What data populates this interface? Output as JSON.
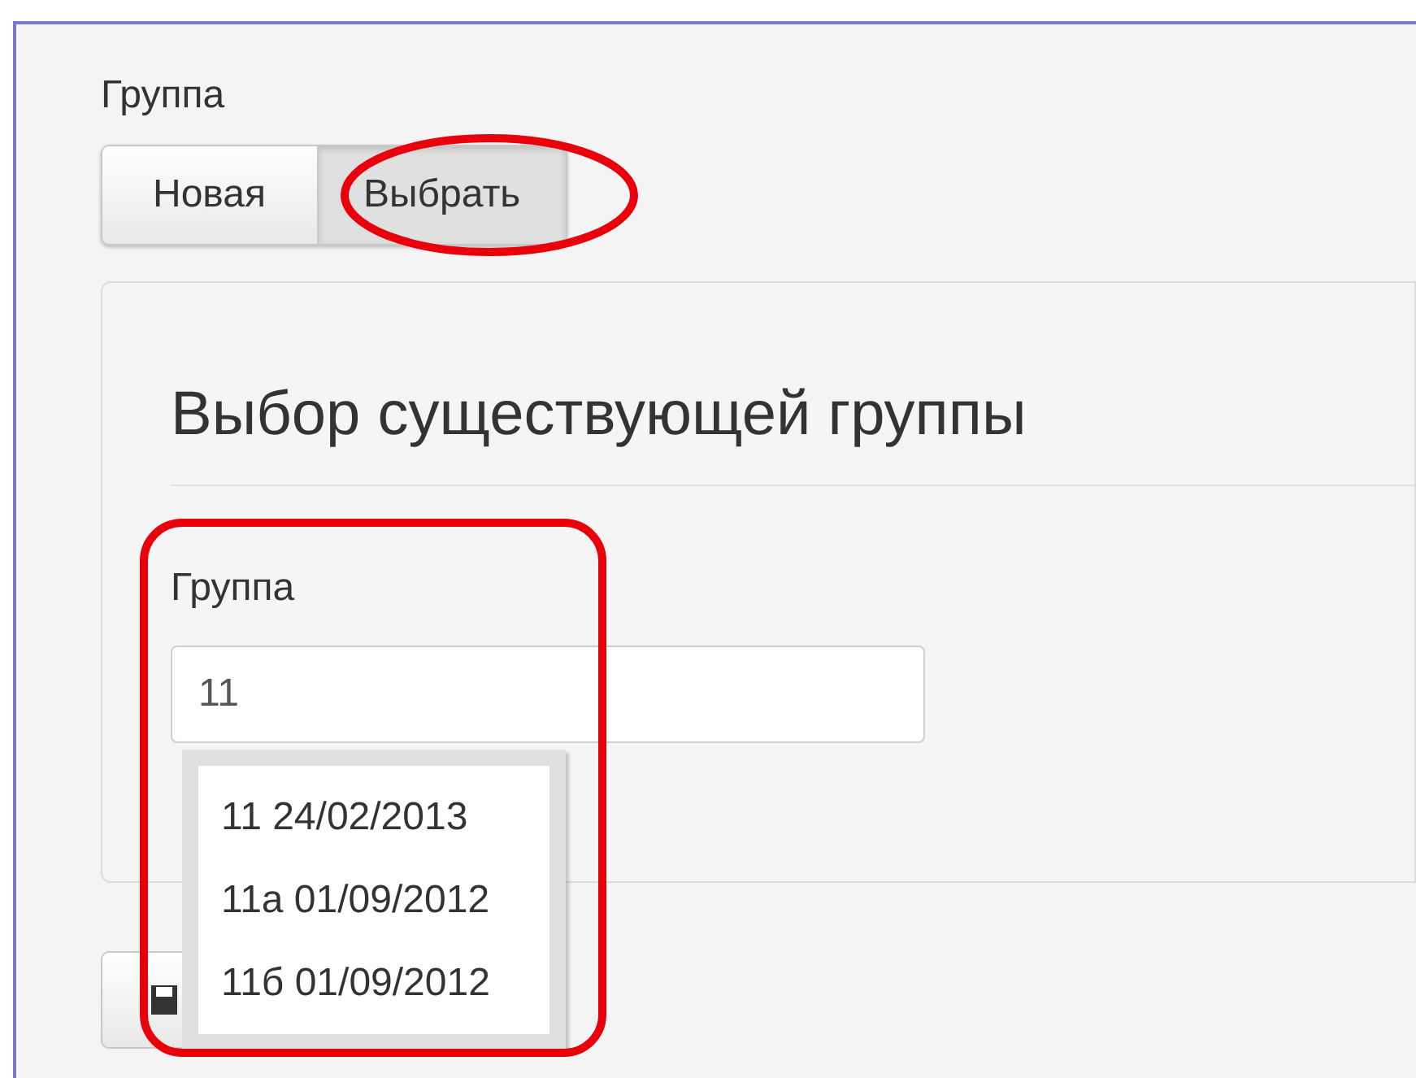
{
  "group_label": "Группа",
  "mode_buttons": [
    {
      "label": "Новая",
      "selected": false
    },
    {
      "label": "Выбрать",
      "selected": true
    }
  ],
  "panel": {
    "title": "Выбор существующей группы",
    "field_label": "Группа",
    "field_value": "11",
    "suggestions": [
      "11 24/02/2013",
      "11a 01/09/2012",
      "11б 01/09/2012"
    ]
  }
}
